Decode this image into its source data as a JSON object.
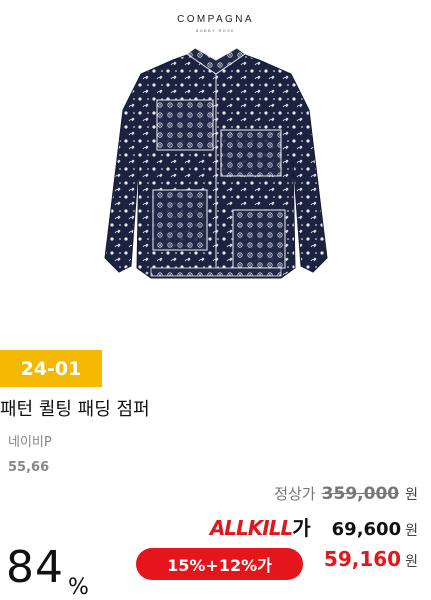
{
  "brand": {
    "name": "COMPAGNA",
    "sub": "BOBBY ROSE"
  },
  "product": {
    "season_badge": "24-01",
    "name": "패턴 퀼팅 패딩 점퍼",
    "color": "네이비P",
    "sizes": "55,66",
    "image_icon": "jacket-icon"
  },
  "price": {
    "regular_label": "정상가",
    "regular_price": "359,000",
    "currency": "원",
    "allkill_logo_main": "ALLKILL",
    "allkill_logo_ga": "가",
    "allkill_price": "69,600",
    "discount_rate": "84",
    "discount_unit": "%",
    "coupon_text": "15%+12%가",
    "final_price": "59,160"
  },
  "colors": {
    "badge": "#f5b800",
    "accent_red": "#e5161b",
    "jacket_navy": "#1c2340"
  }
}
